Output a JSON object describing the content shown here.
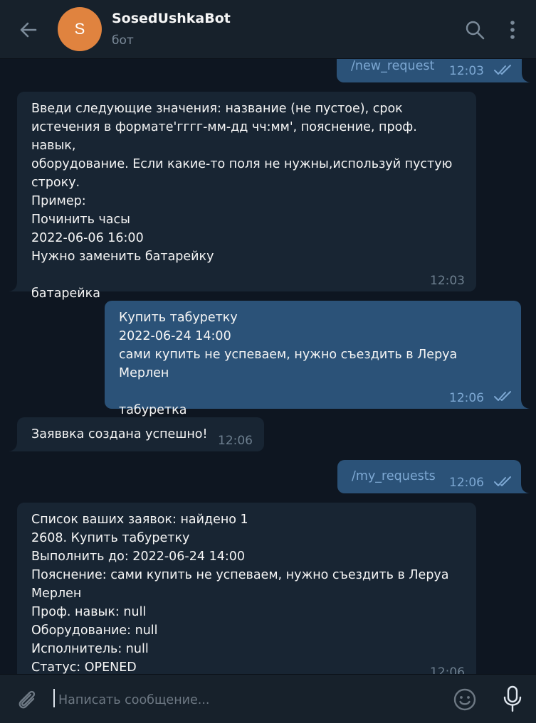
{
  "header": {
    "avatar_letter": "S",
    "avatar_color": "#e0833f",
    "title": "SosedUshkaBot",
    "subtitle": "бот",
    "icons": [
      "back-arrow-icon",
      "search-icon",
      "more-vert-icon"
    ]
  },
  "messages": [
    {
      "direction": "outgoing",
      "text": "/new_request",
      "time": "12:03",
      "read": true
    },
    {
      "direction": "incoming",
      "text": "Введи следующие значения: название (не пустое), срок\nистечения в формате'гггг-мм-дд чч:мм', пояснение, проф. навык,\nоборудование. Если какие-то поля не нужны,используй пустую\nстроку.\nПример:\nПочинить часы\n2022-06-06 16:00\nНужно заменить батарейку\n\nбатарейка",
      "time": "12:03"
    },
    {
      "direction": "outgoing",
      "text": "Купить табуретку\n2022-06-24 14:00\nсами купить не успеваем, нужно съездить в Леруа Мерлен\n\nтабуретка",
      "time": "12:06",
      "read": true
    },
    {
      "direction": "incoming",
      "text": "Заяввка создана успешно!",
      "time": "12:06"
    },
    {
      "direction": "outgoing",
      "text": "/my_requests",
      "time": "12:06",
      "read": true
    },
    {
      "direction": "incoming",
      "text": "Список ваших заявок: найдено 1\n2608. Купить табуретку\nВыполнить до: 2022-06-24 14:00\nПояснение: сами купить не успеваем, нужно съездить в Леруа\nМерлен\nПроф. навык: null\nОборудование: null\nИсполнитель: null\nСтатус: OPENED",
      "time": "12:06"
    }
  ],
  "composer": {
    "placeholder": "Написать сообщение...",
    "value": "",
    "icons": [
      "paperclip-icon",
      "emoji-icon",
      "microphone-icon"
    ]
  },
  "colors": {
    "background": "#0e1621",
    "panel": "#17212b",
    "incoming_bubble": "#182533",
    "outgoing_bubble": "#2b5278",
    "link_blue": "#7da8d3"
  }
}
